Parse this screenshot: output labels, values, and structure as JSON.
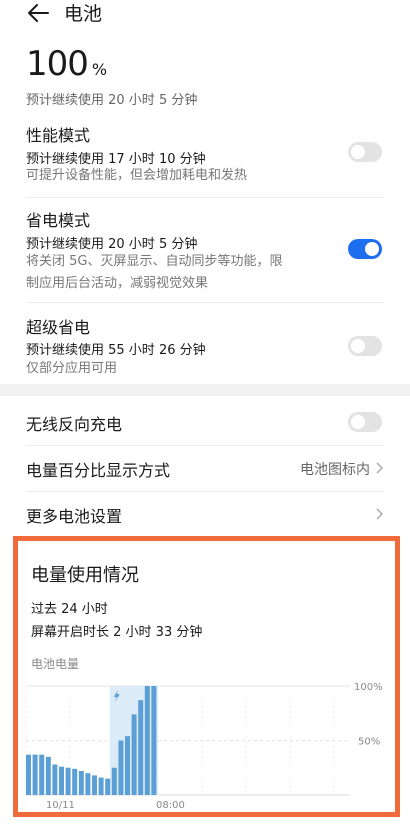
{
  "header": {
    "title": "电池"
  },
  "battery": {
    "percent": "100",
    "unit": "%",
    "remaining": "预计继续使用 20 小时 5 分钟"
  },
  "performance_mode": {
    "title": "性能模式",
    "estimate": "预计继续使用 17 小时 10 分钟",
    "desc": "可提升设备性能，但会增加耗电和发热",
    "enabled": false
  },
  "power_saving_mode": {
    "title": "省电模式",
    "estimate": "预计继续使用 20 小时 5 分钟",
    "desc_line1": "将关闭 5G、灭屏显示、自动同步等功能，限",
    "desc_line2": "制应用后台活动，减弱视觉效果",
    "enabled": true
  },
  "super_power_saving": {
    "title": "超级省电",
    "estimate": "预计继续使用 55 小时 26 分钟",
    "desc": "仅部分应用可用",
    "enabled": false
  },
  "wireless_reverse_charging": {
    "title": "无线反向充电",
    "enabled": false
  },
  "percentage_display": {
    "title": "电量百分比显示方式",
    "value": "电池图标内"
  },
  "more_settings": {
    "title": "更多电池设置"
  },
  "usage": {
    "title": "电量使用情况",
    "range": "过去 24 小时",
    "screen_on": "屏幕开启时长 2 小时 33 分钟"
  },
  "chart_data": {
    "type": "bar",
    "title": "电池电量",
    "x_tick_labels": [
      "10/11",
      "08:00"
    ],
    "y_tick_labels": [
      "100%",
      "50%"
    ],
    "ylim": [
      0,
      100
    ],
    "grid": true,
    "charging_marker": "lightning-icon",
    "values": [
      37,
      37,
      37,
      35,
      28,
      26,
      25,
      24,
      22,
      20,
      18,
      16,
      15,
      25,
      50,
      54,
      74,
      87,
      100,
      100
    ],
    "charging_bar_indices": [
      13,
      14,
      15,
      16,
      17,
      18,
      19
    ],
    "bar_color": "#5b9fd6",
    "charging_highlight_color": "#dcebf8"
  }
}
